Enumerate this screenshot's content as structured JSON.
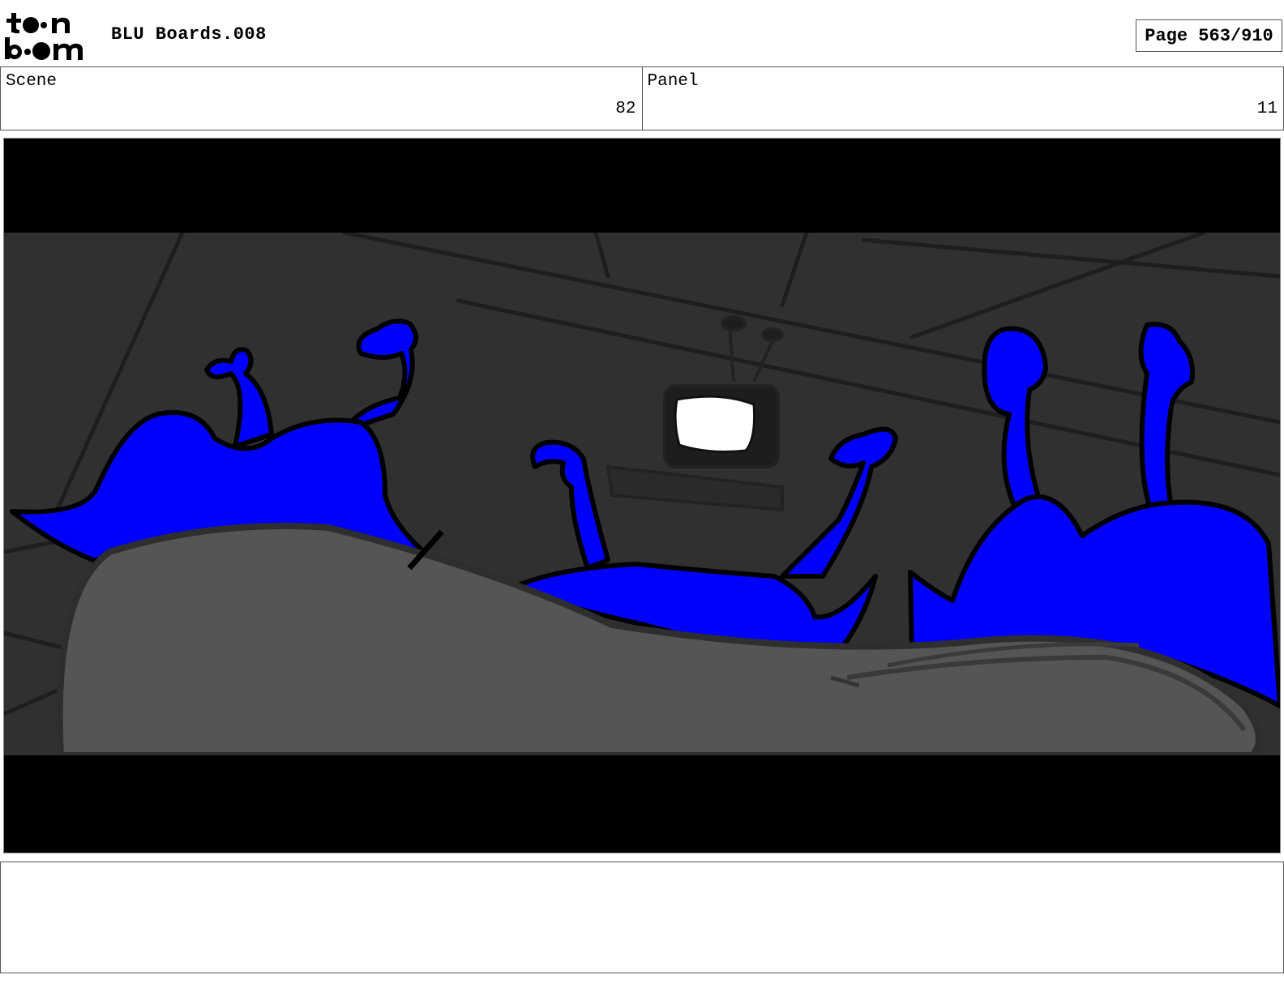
{
  "header": {
    "logo_icon": "toon-boom-logo",
    "title": "BLU Boards.008",
    "page_label": "Page 563/910"
  },
  "scene": {
    "label": "Scene",
    "value": "82"
  },
  "panel": {
    "label": "Panel",
    "value": "11"
  },
  "image": {
    "letterbox_color": "#000000",
    "wall_color": "#303030",
    "floor_color": "#555555",
    "creature_color": "#0000ff",
    "screen_color": "#ffffff"
  },
  "notes": {
    "text": ""
  }
}
